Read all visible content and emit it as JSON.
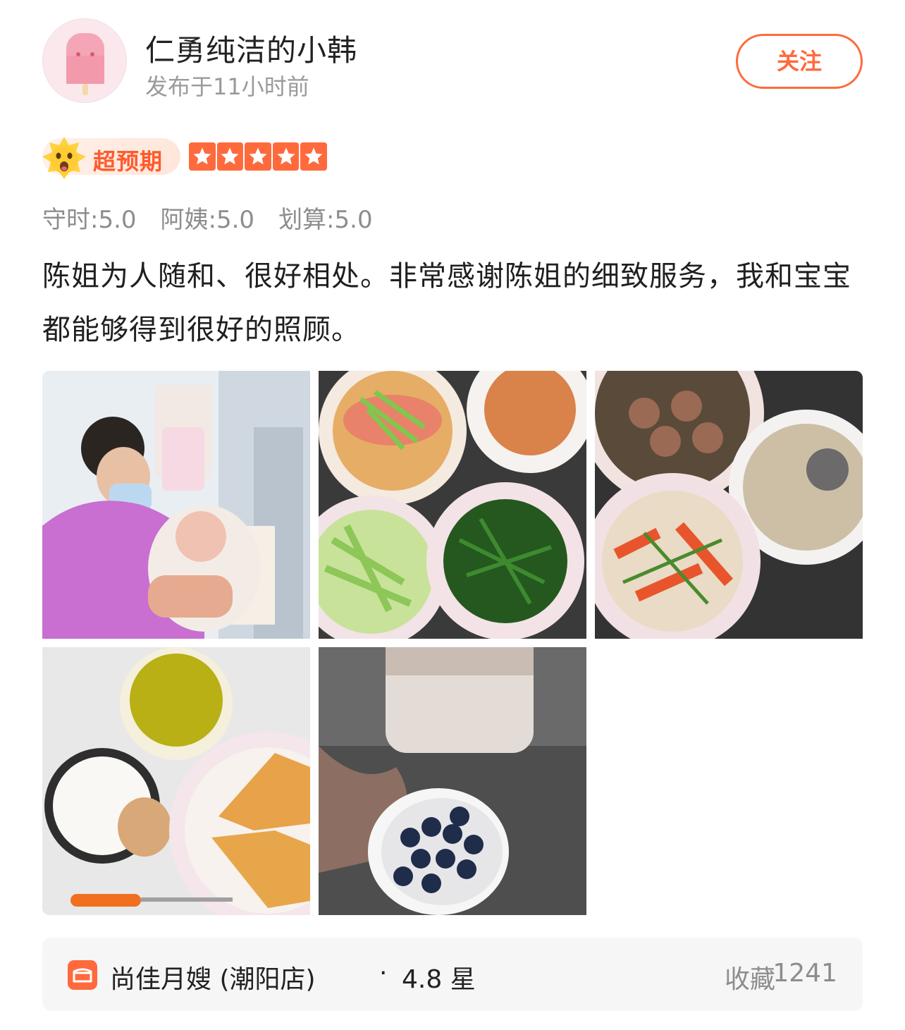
{
  "user": {
    "name": "仁勇纯洁的小韩",
    "publish_time": "发布于11小时前",
    "follow_label": "关注",
    "avatar_icon": "pink-popsicle-avatar"
  },
  "rating": {
    "badge_label": "超预期",
    "badge_icon": "surprised-face-emoji",
    "stars": 5,
    "stars_max": 5,
    "star_color": "#ff6a3d"
  },
  "scores": [
    {
      "label": "守时:5.0"
    },
    {
      "label": "阿姨:5.0"
    },
    {
      "label": "划算:5.0"
    }
  ],
  "review_text": "陈姐为人随和、很好相处。非常感谢陈姐的细致服务，我和宝宝都能够得到很好的照顾。",
  "photos": [
    {
      "subject": "caregiver-holding-baby"
    },
    {
      "subject": "fish-celery-greens-dishes"
    },
    {
      "subject": "meatballs-soup-stirfry-dishes"
    },
    {
      "subject": "juice-egg-toast-breakfast"
    },
    {
      "subject": "milk-and-blueberries"
    }
  ],
  "shop": {
    "name": "尚佳月嫂 (潮阳店)",
    "separator": "·",
    "rating": "4.8 星",
    "collect_label": "收藏",
    "collect_count": "1241",
    "icon": "shop-store-icon"
  },
  "colors": {
    "accent": "#ff6a3d",
    "muted_text": "#8d8d8d",
    "bar_bg": "#f6f6f6"
  }
}
